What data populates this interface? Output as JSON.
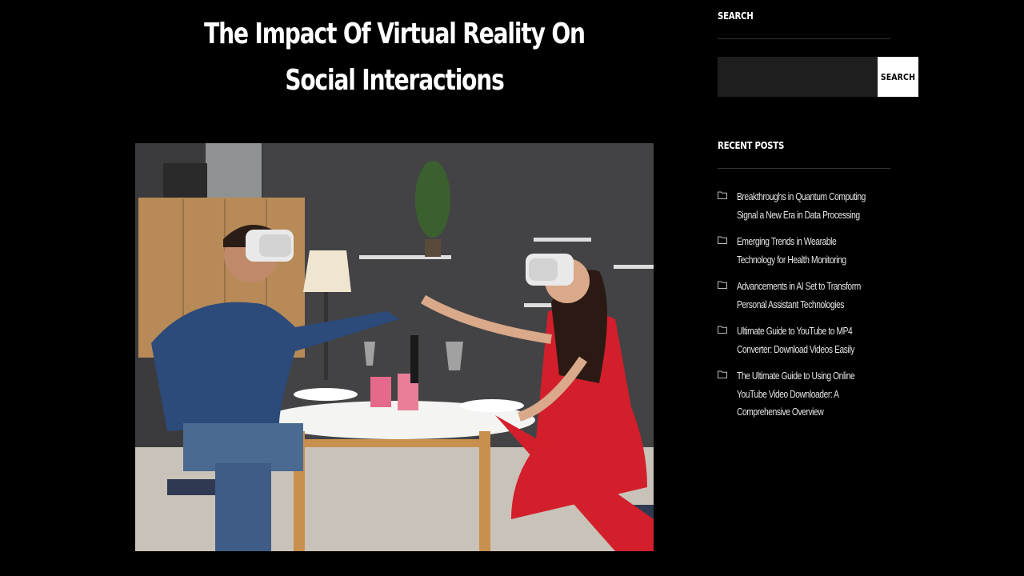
{
  "article": {
    "title": "The Impact Of Virtual Reality On Social Interactions",
    "image_subject": "Couple wearing VR headsets touching hands at a dining table"
  },
  "sidebar": {
    "search": {
      "heading": "SEARCH",
      "input_value": "",
      "button_label": "SEARCH"
    },
    "recent_posts": {
      "heading": "RECENT POSTS",
      "items": [
        {
          "label": "Breakthroughs in Quantum Computing Signal a New Era in Data Processing",
          "icon": "folder-icon"
        },
        {
          "label": "Emerging Trends in Wearable Technology for Health Monitoring",
          "icon": "folder-icon"
        },
        {
          "label": "Advancements in AI Set to Transform Personal Assistant Technologies",
          "icon": "folder-icon"
        },
        {
          "label": "Ultimate Guide to YouTube to MP4 Converter: Download Videos Easily",
          "icon": "folder-icon"
        },
        {
          "label": "The Ultimate Guide to Using Online YouTube Video Downloader: A Comprehensive Overview",
          "icon": "folder-icon"
        }
      ]
    }
  },
  "colors": {
    "background": "#000000",
    "text": "#ffffff",
    "search_input_bg": "#1e1e1e",
    "search_button_bg": "#ffffff"
  }
}
